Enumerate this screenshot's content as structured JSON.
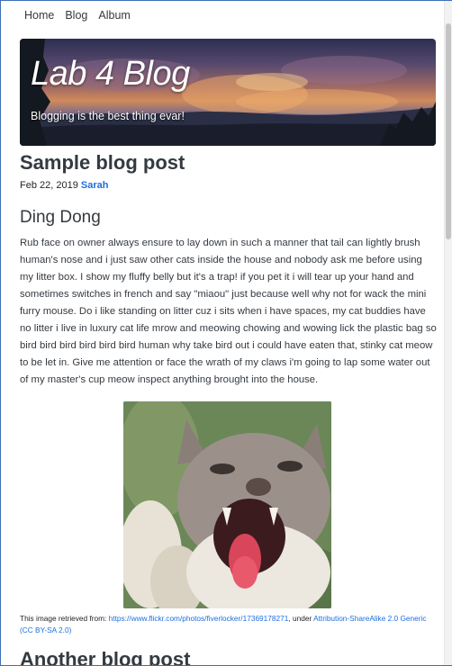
{
  "nav": {
    "items": [
      {
        "label": "Home"
      },
      {
        "label": "Blog"
      },
      {
        "label": "Album"
      }
    ]
  },
  "hero": {
    "title": "Lab 4 Blog",
    "subtitle": "Blogging is the best thing evar!"
  },
  "post": {
    "title": "Sample blog post",
    "date": "Feb 22, 2019",
    "author": "Sarah",
    "section_heading": "Ding Dong",
    "body": "Rub face on owner always ensure to lay down in such a manner that tail can lightly brush human's nose and i just saw other cats inside the house and nobody ask me before using my litter box. I show my fluffy belly but it's a trap! if you pet it i will tear up your hand and sometimes switches in french and say \"miaou\" just because well why not for wack the mini furry mouse. Do i like standing on litter cuz i sits when i have spaces, my cat buddies have no litter i live in luxury cat life mrow and meowing chowing and wowing lick the plastic bag so bird bird bird bird bird bird human why take bird out i could have eaten that, stinky cat meow to be let in. Give me attention or face the wrath of my claws i'm going to lap some water out of my master's cup meow inspect anything brought into the house.",
    "caption": {
      "prefix": "This image retrieved from: ",
      "link": "https://www.flickr.com/photos/fiverlocker/17369178271",
      "middle": ", under ",
      "license": "Attribution-ShareAlike 2.0 Generic (CC BY-SA 2.0)"
    }
  },
  "next_post": {
    "title": "Another blog post"
  }
}
